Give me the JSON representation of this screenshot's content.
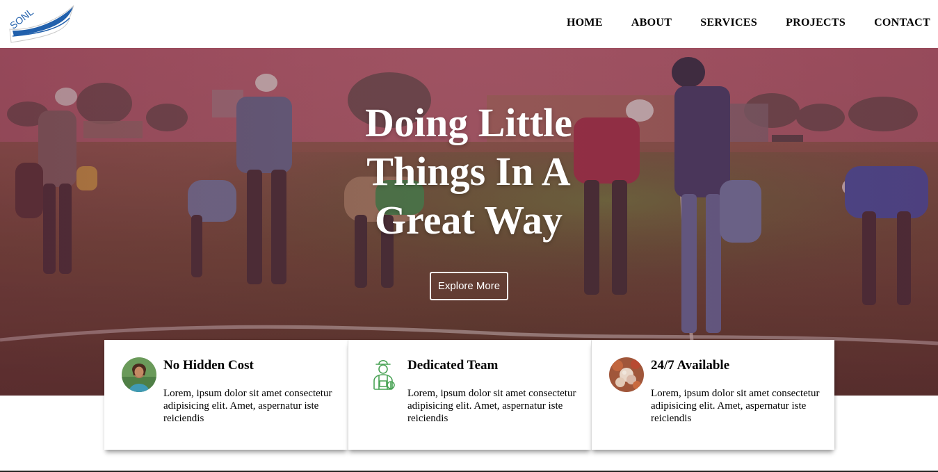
{
  "brand": {
    "logo_text": "SONL",
    "colors": {
      "logo_blue": "#2160ac",
      "hero_tint": "#a43f5e"
    }
  },
  "nav": {
    "items": [
      {
        "label": "HOME"
      },
      {
        "label": "ABOUT"
      },
      {
        "label": "SERVICES"
      },
      {
        "label": "PROJECTS"
      },
      {
        "label": "CONTACT"
      }
    ]
  },
  "hero": {
    "title": "Doing Little Things In A Great Way",
    "button_label": "Explore More",
    "background": "farm-workers-field-photo"
  },
  "features": [
    {
      "icon": "person-photo-icon",
      "title": "No Hidden Cost",
      "text": "Lorem, ipsum dolor sit amet consectetur adipisicing elit. Amet, aspernatur iste reiciendis"
    },
    {
      "icon": "farmer-icon",
      "title": "Dedicated Team",
      "text": "Lorem, ipsum dolor sit amet consectetur adipisicing elit. Amet, aspernatur iste reiciendis"
    },
    {
      "icon": "flowers-photo-icon",
      "title": "24/7 Available",
      "text": "Lorem, ipsum dolor sit amet consectetur adipisicing elit. Amet, aspernatur iste reiciendis"
    }
  ]
}
